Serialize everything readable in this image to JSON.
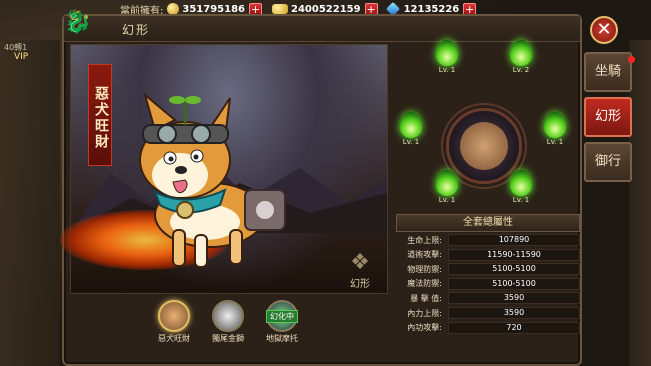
{
  "topbar": {
    "label": "當前擁有:",
    "coins": "351795186",
    "ingots": "2400522159",
    "gems": "12135226"
  },
  "panel": {
    "title": "幻形"
  },
  "pet": {
    "name": "惡犬旺財",
    "form_label": "幻形"
  },
  "wheel": {
    "slots": [
      {
        "level": "Lv. 1"
      },
      {
        "level": "Lv. 2"
      },
      {
        "level": "Lv. 1"
      },
      {
        "level": "Lv. 1"
      },
      {
        "level": "Lv. 1"
      },
      {
        "level": "Lv. 1"
      }
    ]
  },
  "stats": {
    "header": "全套總屬性",
    "rows": [
      {
        "key": "生命上限:",
        "value": "107890"
      },
      {
        "key": "道術攻擊:",
        "value": "11590-11590"
      },
      {
        "key": "物理防禦:",
        "value": "5100-5100"
      },
      {
        "key": "魔法防禦:",
        "value": "5100-5100"
      },
      {
        "key": "暴 擊 值:",
        "value": "3590"
      },
      {
        "key": "內力上限:",
        "value": "3590"
      },
      {
        "key": "內功攻擊:",
        "value": "720"
      }
    ]
  },
  "pet_bar": [
    {
      "label": "惡犬旺財",
      "tag": ""
    },
    {
      "label": "獨尾金獅",
      "tag": ""
    },
    {
      "label": "地獄摩托",
      "tag": "幻化中"
    }
  ],
  "tabs": [
    "坐騎",
    "幻形",
    "御行"
  ],
  "hud": {
    "vip": "VIP",
    "level": "40轉1"
  },
  "colors": {
    "accent_red": "#c02a20",
    "flame_green": "#58d020",
    "gold": "#e0c060"
  }
}
